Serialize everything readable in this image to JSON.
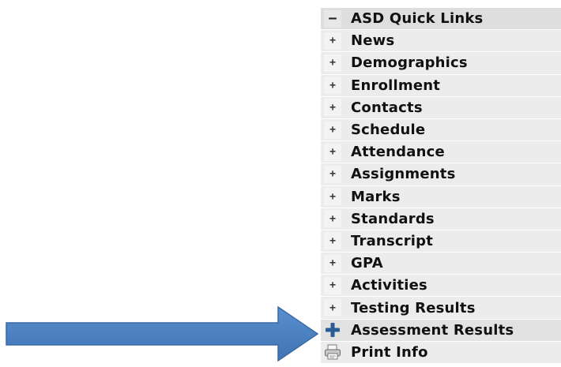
{
  "menu": {
    "header": {
      "toggle": "−",
      "label": "ASD Quick Links"
    },
    "items": [
      {
        "toggle": "+",
        "label": "News"
      },
      {
        "toggle": "+",
        "label": "Demographics"
      },
      {
        "toggle": "+",
        "label": "Enrollment"
      },
      {
        "toggle": "+",
        "label": "Contacts"
      },
      {
        "toggle": "+",
        "label": "Schedule"
      },
      {
        "toggle": "+",
        "label": "Attendance"
      },
      {
        "toggle": "+",
        "label": "Assignments"
      },
      {
        "toggle": "+",
        "label": "Marks"
      },
      {
        "toggle": "+",
        "label": "Standards"
      },
      {
        "toggle": "+",
        "label": "Transcript"
      },
      {
        "toggle": "+",
        "label": "GPA"
      },
      {
        "toggle": "+",
        "label": "Activities"
      },
      {
        "toggle": "+",
        "label": "Testing Results"
      },
      {
        "toggle": "+",
        "label": "Assessment Results",
        "icon": "blue-plus-icon"
      }
    ],
    "print": {
      "icon": "printer-icon",
      "label": "Print Info"
    }
  },
  "annotation": {
    "arrow_icon": "right-arrow-icon",
    "arrow_color": "#4a7fc0",
    "target": "Assessment Results"
  },
  "colors": {
    "row_background": "#ececec",
    "header_background": "#dedede",
    "text": "#111111",
    "blue_plus": "#2a5d91"
  }
}
